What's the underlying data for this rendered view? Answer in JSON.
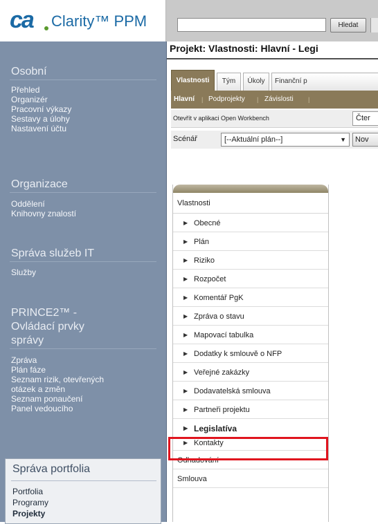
{
  "header": {
    "logo_mark": "ca",
    "app_name": "Clarity™ PPM",
    "search_placeholder": "",
    "search_button": "Hledat"
  },
  "sidebar": {
    "sections": [
      {
        "title": "Osobní",
        "items": [
          "Přehled",
          "Organizér",
          "Pracovní výkazy",
          "Sestavy a úlohy",
          "Nastavení účtu"
        ]
      },
      {
        "title": "Organizace",
        "items": [
          "Oddělení",
          "Knihovny znalostí"
        ]
      },
      {
        "title": "Správa služeb IT",
        "items": [
          "Služby"
        ]
      },
      {
        "title_lines": [
          "PRINCE2™ -",
          "Ovládací prvky",
          "správy"
        ],
        "items": [
          "Zpráva",
          "Plán fáze",
          "Seznam rizik, otevřených",
          "otázek a změn",
          "Seznam ponaučení",
          "Panel vedoucího"
        ]
      }
    ],
    "portfolio": {
      "title": "Správa portfolia",
      "items": [
        "Portfolia",
        "Programy",
        "Projekty"
      ]
    }
  },
  "main": {
    "page_title": "Projekt: Vlastnosti: Hlavní - Legi",
    "tabs": [
      "Vlastnosti",
      "Tým",
      "Úkoly",
      "Finanční p"
    ],
    "subtabs": [
      "Hlavní",
      "Podprojekty",
      "Závislosti"
    ],
    "open_workbench": "Otevřít v aplikaci Open Workbench",
    "read_button": "Čter",
    "scenario_label": "Scénář",
    "scenario_value": "[--Aktuální plán--]",
    "new_button": "Nov"
  },
  "property_menu": {
    "header": "Vlastnosti",
    "items": [
      "Obecné",
      "Plán",
      "Riziko",
      "Rozpočet",
      "Komentář PgK",
      "Zpráva o stavu",
      "Mapovací tabulka",
      "Dodatky k smlouvě o NFP",
      "Veřejné zakázky",
      "Dodavatelská smlouva",
      "Partneři projektu",
      "Legislatíva",
      "Kontakty"
    ],
    "selected_item": "Legislatíva",
    "footer_items": [
      "Odhadování",
      "Smlouva"
    ]
  },
  "colors": {
    "sidebar_bg": "#7e90a8",
    "tab_active": "#8a7a59",
    "highlight_border": "#e0141e",
    "logo_blue": "#1b6aa5"
  }
}
